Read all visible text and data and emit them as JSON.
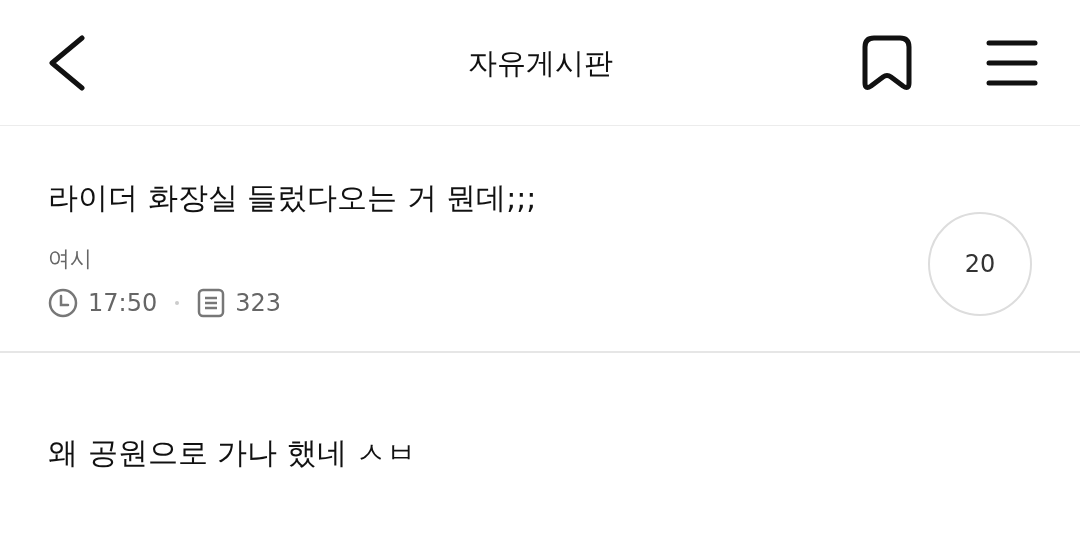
{
  "header": {
    "title": "자유게시판"
  },
  "posts": [
    {
      "title": "라이더 화장실 들렀다오는 거 뭔데;;;",
      "author": "여시",
      "time": "17:50",
      "views": "323",
      "comments": "20"
    },
    {
      "title": "왜 공원으로 가나 했네 ㅅㅂ"
    }
  ]
}
